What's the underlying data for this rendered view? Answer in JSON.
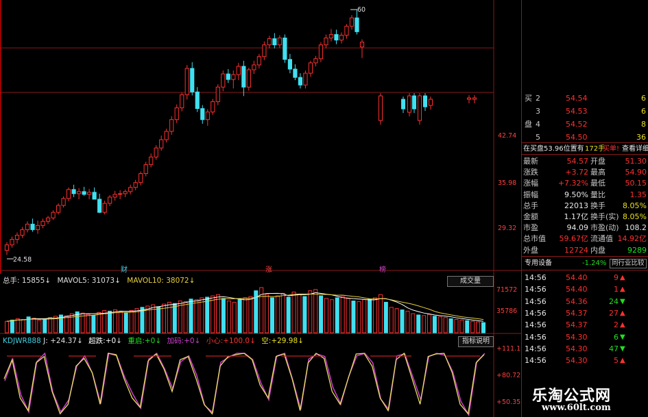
{
  "colors": {
    "up": "#ff3030",
    "down": "#40e0f0",
    "grid": "#8a1a1a",
    "ma5": "#ffffff",
    "ma10": "#e8d040",
    "ind1": "#e8e060",
    "ind2": "#d040d0"
  },
  "price_axis": {
    "high_label": "60",
    "low_label": "24.58",
    "ticks": [
      "42.74",
      "35.98",
      "29.32"
    ]
  },
  "markers": [
    "财",
    "涨",
    "榜"
  ],
  "volume_header": {
    "total_label": "总手:",
    "total": "15855",
    "ma5_label": "MAVOL5:",
    "ma5": "31073",
    "ma10_label": "MAVOL10:",
    "ma10": "38072",
    "button": "成交量"
  },
  "volume_axis": [
    "71572",
    "35786"
  ],
  "indicator_header": {
    "name": "KDJWR888",
    "j_label": "J:",
    "j": "+24.37",
    "items": [
      {
        "label": "超跌:",
        "value": "+0"
      },
      {
        "label": "重启:",
        "value": "+0"
      },
      {
        "label": "加码:",
        "value": "+0"
      },
      {
        "label": "小心:",
        "value": "+100.0"
      },
      {
        "label": "空:",
        "value": "+29.98"
      }
    ],
    "button": "指标说明"
  },
  "indicator_axis": [
    "+111.1",
    "+80.72",
    "+50.35"
  ],
  "order_book": [
    {
      "side": "买",
      "level": "2",
      "price": "54.54",
      "vol": "6"
    },
    {
      "side": "",
      "level": "3",
      "price": "54.53",
      "vol": "6"
    },
    {
      "side": "盘",
      "level": "4",
      "price": "54.52",
      "vol": "8"
    },
    {
      "side": "",
      "level": "5",
      "price": "54.50",
      "vol": "36"
    }
  ],
  "notice": {
    "text": "在买盘53.96位置有",
    "qty": "172手",
    "action": "买单!",
    "link": "查看详细"
  },
  "quote": [
    {
      "l1": "最新",
      "v1": "54.57",
      "l2": "开盘",
      "v2": "51.30"
    },
    {
      "l1": "涨跌",
      "v1": "+3.72",
      "l2": "最高",
      "v2": "54.90"
    },
    {
      "l1": "涨幅",
      "v1": "+7.32%",
      "l2": "最低",
      "v2": "50.15"
    },
    {
      "l1": "振幅",
      "v1": "9.50%",
      "l2": "量比",
      "v2": "1.35"
    },
    {
      "l1": "总手",
      "v1": "22013",
      "l2": "换手",
      "v2": "8.05%"
    },
    {
      "l1": "金额",
      "v1": "1.17亿",
      "l2": "换手(实)",
      "v2": "8.05%"
    },
    {
      "l1": "市盈",
      "v1": "94.09",
      "l2": "市盈(动)",
      "v2": "108.2"
    },
    {
      "l1": "总市值",
      "v1": "59.67亿",
      "l2": "流通值",
      "v2": "14.92亿"
    },
    {
      "l1": "外盘",
      "v1": "12724",
      "l2": "内盘",
      "v2": "9289"
    }
  ],
  "industry": {
    "name": "专用设备",
    "change": "-1.24%",
    "button": "同行业比较"
  },
  "trades": [
    {
      "time": "14:56",
      "price": "54.40",
      "vol": "9",
      "dir": "up"
    },
    {
      "time": "14:56",
      "price": "54.40",
      "vol": "1",
      "dir": "up"
    },
    {
      "time": "14:56",
      "price": "54.36",
      "vol": "24",
      "dir": "down"
    },
    {
      "time": "14:56",
      "price": "54.37",
      "vol": "27",
      "dir": "up"
    },
    {
      "time": "14:56",
      "price": "54.37",
      "vol": "2",
      "dir": "up"
    },
    {
      "time": "14:56",
      "price": "54.30",
      "vol": "6",
      "dir": "down"
    },
    {
      "time": "14:56",
      "price": "54.30",
      "vol": "47",
      "dir": "down"
    },
    {
      "time": "14:56",
      "price": "54.30",
      "vol": "5",
      "dir": "up"
    }
  ],
  "watermark": {
    "cn": "乐淘公式网",
    "url": "www.60lt.com"
  },
  "chart_data": {
    "type": "candlestick",
    "candles": [
      [
        25.2,
        26.4,
        24.58,
        26.0
      ],
      [
        26.0,
        27.2,
        25.6,
        26.8
      ],
      [
        26.8,
        27.8,
        26.2,
        27.4
      ],
      [
        27.4,
        28.6,
        27.0,
        28.2
      ],
      [
        28.2,
        29.4,
        27.8,
        29.0
      ],
      [
        29.0,
        29.8,
        27.9,
        28.2
      ],
      [
        28.2,
        29.5,
        27.6,
        28.8
      ],
      [
        28.8,
        29.8,
        28.4,
        29.4
      ],
      [
        29.4,
        30.2,
        29.0,
        29.9
      ],
      [
        29.9,
        31.0,
        29.6,
        30.7
      ],
      [
        30.7,
        32.0,
        30.4,
        31.7
      ],
      [
        31.7,
        33.0,
        31.4,
        32.7
      ],
      [
        32.7,
        34.3,
        32.3,
        34.0
      ],
      [
        34.0,
        34.7,
        32.9,
        33.4
      ],
      [
        33.4,
        34.2,
        32.6,
        33.7
      ],
      [
        33.7,
        34.4,
        33.1,
        33.3
      ],
      [
        33.3,
        34.1,
        32.6,
        33.6
      ],
      [
        33.6,
        34.3,
        33.0,
        32.6
      ],
      [
        32.6,
        33.4,
        30.6,
        30.7
      ],
      [
        30.7,
        32.4,
        30.4,
        32.0
      ],
      [
        32.0,
        33.2,
        31.6,
        32.9
      ],
      [
        32.9,
        33.8,
        32.4,
        33.3
      ],
      [
        33.3,
        33.9,
        32.6,
        33.4
      ],
      [
        33.4,
        34.0,
        32.9,
        33.7
      ],
      [
        33.7,
        34.7,
        33.3,
        34.3
      ],
      [
        34.3,
        35.4,
        33.9,
        35.0
      ],
      [
        35.0,
        36.6,
        34.6,
        36.3
      ],
      [
        36.3,
        38.0,
        35.9,
        37.6
      ],
      [
        37.6,
        39.2,
        37.2,
        38.7
      ],
      [
        38.7,
        40.4,
        38.3,
        40.0
      ],
      [
        40.0,
        41.8,
        39.6,
        41.2
      ],
      [
        41.2,
        42.8,
        40.8,
        42.4
      ],
      [
        42.4,
        44.6,
        41.9,
        44.1
      ],
      [
        44.1,
        46.3,
        43.6,
        45.8
      ],
      [
        45.8,
        48.0,
        45.3,
        47.7
      ],
      [
        47.7,
        52.0,
        47.0,
        51.5
      ],
      [
        51.5,
        52.4,
        47.6,
        48.1
      ],
      [
        48.1,
        48.8,
        45.2,
        45.7
      ],
      [
        45.7,
        46.2,
        43.5,
        44.1
      ],
      [
        44.1,
        45.6,
        43.2,
        45.2
      ],
      [
        45.2,
        47.1,
        44.8,
        46.7
      ],
      [
        46.7,
        49.2,
        46.2,
        48.8
      ],
      [
        48.8,
        51.2,
        48.2,
        50.7
      ],
      [
        50.7,
        51.4,
        49.4,
        49.9
      ],
      [
        49.9,
        51.2,
        48.6,
        50.6
      ],
      [
        50.6,
        52.3,
        49.8,
        51.8
      ],
      [
        51.8,
        52.6,
        47.5,
        48.8
      ],
      [
        48.8,
        51.6,
        48.3,
        51.3
      ],
      [
        51.3,
        52.6,
        50.7,
        52.0
      ],
      [
        52.0,
        53.6,
        51.5,
        53.2
      ],
      [
        53.2,
        55.4,
        52.7,
        54.9
      ],
      [
        54.9,
        56.2,
        54.4,
        55.8
      ],
      [
        55.8,
        56.6,
        54.4,
        54.9
      ],
      [
        54.9,
        56.3,
        54.5,
        55.9
      ],
      [
        55.9,
        56.4,
        52.3,
        52.8
      ],
      [
        52.8,
        53.6,
        50.8,
        51.4
      ],
      [
        51.4,
        52.1,
        49.8,
        50.2
      ],
      [
        50.2,
        50.8,
        48.6,
        49.1
      ],
      [
        49.1,
        51.2,
        48.6,
        50.8
      ],
      [
        50.8,
        52.6,
        50.3,
        52.3
      ],
      [
        52.3,
        53.3,
        51.8,
        52.9
      ],
      [
        52.9,
        55.3,
        52.4,
        54.9
      ],
      [
        54.9,
        56.4,
        54.4,
        55.9
      ],
      [
        55.9,
        57.2,
        55.4,
        56.4
      ],
      [
        56.4,
        57.1,
        55.0,
        55.6
      ],
      [
        55.6,
        56.7,
        55.1,
        56.3
      ],
      [
        56.3,
        57.9,
        55.8,
        57.6
      ],
      [
        57.6,
        59.2,
        57.1,
        58.8
      ],
      [
        58.8,
        60.0,
        56.4,
        56.8
      ],
      [
        54.6,
        55.7,
        53.0,
        55.3
      ]
    ],
    "volume": [
      18,
      20,
      22,
      21,
      25,
      23,
      20,
      22,
      24,
      26,
      28,
      27,
      30,
      33,
      31,
      29,
      27,
      32,
      35,
      34,
      36,
      33,
      31,
      35,
      38,
      40,
      42,
      44,
      41,
      45,
      48,
      46,
      50,
      49,
      53,
      52,
      55,
      56,
      58,
      60,
      54,
      50,
      48,
      52,
      55,
      57,
      66,
      71,
      60,
      55,
      58,
      62,
      56,
      64,
      60,
      57,
      66,
      68,
      58,
      54,
      52,
      55,
      57,
      54,
      50,
      49,
      52,
      53,
      55,
      60,
      48,
      40,
      38,
      36,
      34,
      30,
      28,
      27,
      29,
      26,
      25,
      24,
      22,
      21,
      20,
      19,
      18,
      17,
      16
    ],
    "ylim": [
      24.58,
      60
    ]
  }
}
